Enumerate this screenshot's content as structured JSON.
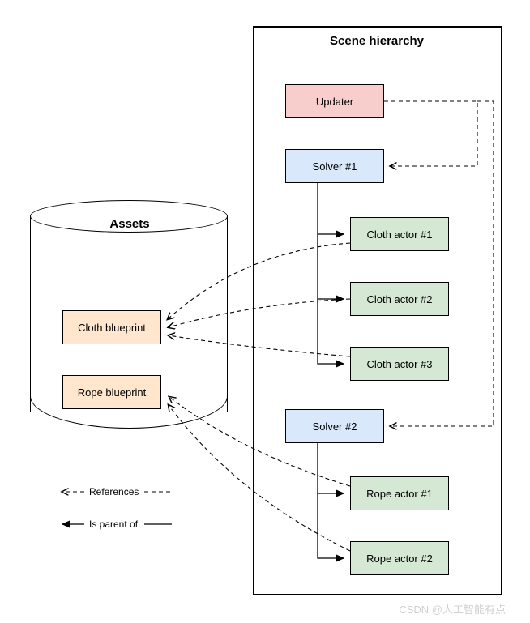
{
  "hierarchy": {
    "title": "Scene hierarchy",
    "updater": "Updater",
    "solver1": "Solver #1",
    "solver2": "Solver #2",
    "cloth_actor1": "Cloth actor #1",
    "cloth_actor2": "Cloth actor #2",
    "cloth_actor3": "Cloth actor #3",
    "rope_actor1": "Rope actor #1",
    "rope_actor2": "Rope actor #2"
  },
  "assets": {
    "title": "Assets",
    "cloth_blueprint": "Cloth blueprint",
    "rope_blueprint": "Rope blueprint"
  },
  "legend": {
    "references": "References",
    "is_parent_of": "Is parent of"
  },
  "watermark": "CSDN @人工智能有点"
}
